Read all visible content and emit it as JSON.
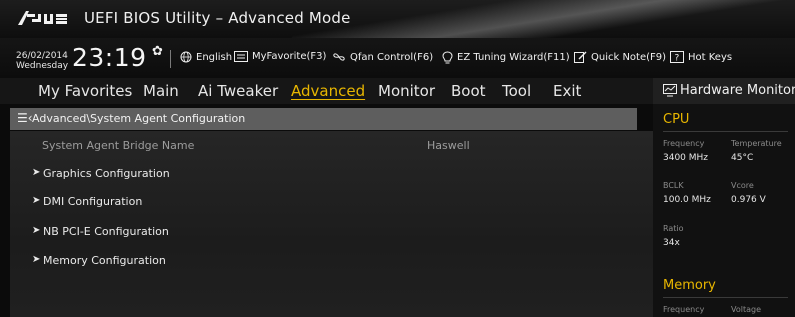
{
  "titlebar": {
    "logo": "/ISUS",
    "title": "UEFI BIOS Utility – Advanced Mode"
  },
  "toolbar": {
    "date": "26/02/2014",
    "weekday": "Wednesday",
    "time": "23:19",
    "settings_icon": "gear-icon",
    "items": [
      {
        "icon": "globe-icon",
        "label": "English"
      },
      {
        "icon": "myfavorite-icon",
        "label": "MyFavorite(F3)"
      },
      {
        "icon": "fan-icon",
        "label": "Qfan Control(F6)"
      },
      {
        "icon": "bulb-icon",
        "label": "EZ Tuning Wizard(F11)"
      },
      {
        "icon": "note-icon",
        "label": "Quick Note(F9)"
      },
      {
        "icon": "help-icon",
        "label": "Hot Keys"
      }
    ]
  },
  "menu": {
    "items": [
      "My Favorites",
      "Main",
      "Ai Tweaker",
      "Advanced",
      "Monitor",
      "Boot",
      "Tool",
      "Exit"
    ],
    "active": "Advanced"
  },
  "breadcrumb": {
    "text": "Advanced\\System Agent Configuration"
  },
  "main": {
    "info": {
      "label": "System Agent Bridge Name",
      "value": "Haswell"
    },
    "submenus": [
      "Graphics Configuration",
      "DMI Configuration",
      "NB PCI-E Configuration",
      "Memory Configuration"
    ]
  },
  "hwmon": {
    "title": "Hardware Monitor",
    "cpu": {
      "title": "CPU",
      "frequency_label": "Frequency",
      "frequency": "3400 MHz",
      "temperature_label": "Temperature",
      "temperature": "45°C",
      "bclk_label": "BCLK",
      "bclk": "100.0 MHz",
      "vcore_label": "Vcore",
      "vcore": "0.976 V",
      "ratio_label": "Ratio",
      "ratio": "34x"
    },
    "memory": {
      "title": "Memory",
      "frequency_label": "Frequency",
      "voltage_label": "Voltage"
    }
  },
  "colors": {
    "accent": "#e8b600",
    "breadcrumb_bg": "#5e5e5e",
    "background": "#0b0b0b"
  }
}
